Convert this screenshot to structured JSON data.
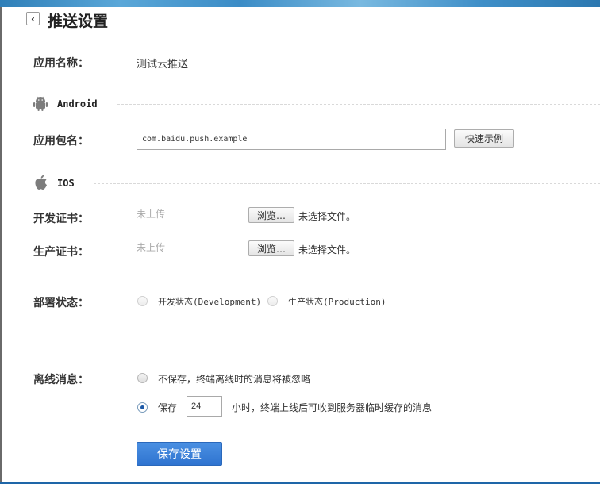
{
  "header": {
    "back_symbol": "‹",
    "title": "推送设置"
  },
  "app": {
    "name_label": "应用名称：",
    "name_value": "测试云推送"
  },
  "android": {
    "section_title": "Android",
    "icon": "android-icon",
    "package_label": "应用包名：",
    "package_value": "com.baidu.push.example",
    "example_button": "快速示例"
  },
  "ios": {
    "section_title": "IOS",
    "icon": "apple-icon",
    "dev_cert_label": "开发证书：",
    "dev_cert_status": "未上传",
    "dev_browse_button": "浏览…",
    "dev_file_status": "未选择文件。",
    "prod_cert_label": "生产证书：",
    "prod_cert_status": "未上传",
    "prod_browse_button": "浏览…",
    "prod_file_status": "未选择文件。",
    "deploy_label": "部署状态：",
    "deploy_options": [
      {
        "label": "开发状态(Development)",
        "selected": false
      },
      {
        "label": "生产状态(Production)",
        "selected": false
      }
    ]
  },
  "offline": {
    "label": "离线消息：",
    "option_discard": "不保存，终端离线时的消息将被忽略",
    "option_save": "保存",
    "save_hours": "24",
    "save_suffix": "小时，终端上线后可收到服务器临时缓存的消息",
    "selected": "save"
  },
  "save_button": "保存设置",
  "colors": {
    "primary": "#2f74d0",
    "radio_checked": "#1e5aa8"
  }
}
